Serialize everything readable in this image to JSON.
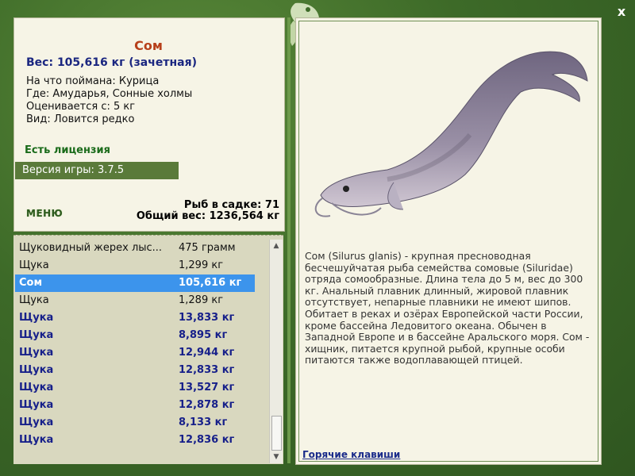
{
  "window": {
    "close_label": "x"
  },
  "fish": {
    "name": "Сом",
    "weight_line": "Вес: 105,616 кг (зачетная)",
    "caught_on": "На что поймана: Курица",
    "where": "Где: Амударья, Сонные холмы",
    "rated_from": "Оценивается с: 5 кг",
    "kind": "Вид: Ловится редко"
  },
  "license": "Есть лицензия",
  "version": "Версия игры: 3.7.5",
  "menu_label": "МЕНЮ",
  "cage": {
    "count": "Рыб в садке: 71",
    "total": "Общий вес: 1236,564 кг"
  },
  "list": [
    {
      "name": "Щуковидный жерех лыс...",
      "weight": "475 грамм",
      "style": "normal"
    },
    {
      "name": "Щука",
      "weight": "1,299 кг",
      "style": "normal"
    },
    {
      "name": "Сом",
      "weight": "105,616 кг",
      "style": "selected"
    },
    {
      "name": "Щука",
      "weight": "1,289 кг",
      "style": "normal"
    },
    {
      "name": "Щука",
      "weight": "13,833 кг",
      "style": "bold"
    },
    {
      "name": "Щука",
      "weight": "8,895 кг",
      "style": "bold"
    },
    {
      "name": "Щука",
      "weight": "12,944 кг",
      "style": "bold"
    },
    {
      "name": "Щука",
      "weight": "12,833 кг",
      "style": "bold"
    },
    {
      "name": "Щука",
      "weight": "13,527 кг",
      "style": "bold"
    },
    {
      "name": "Щука",
      "weight": "12,878 кг",
      "style": "bold"
    },
    {
      "name": "Щука",
      "weight": "8,133 кг",
      "style": "bold"
    },
    {
      "name": "Щука",
      "weight": "12,836 кг",
      "style": "bold"
    }
  ],
  "description": "Сом (Silurus glanis) - крупная пресноводная бесчешуйчатая рыба семейства сомовые (Siluridae) отряда сомообразные. Длина тела до 5 м, вес до 300 кг. Анальный плавник длинный, жировой плавник отсутствует, непарные плавники не имеют шипов. Обитает в реках и озёрах Европейской части России, кроме бассейна Ледовитого океана. Обычен в Западной Европе и в бассейне Аральского моря. Сом - хищник, питается крупной рыбой, крупные особи питаются также водоплавающей птицей.",
  "hotkeys_label": "Горячие клавиши",
  "icons": {
    "close": "close-icon",
    "logo": "leaf-logo-icon",
    "up": "arrow-up-icon",
    "down": "arrow-down-icon"
  },
  "colors": {
    "frame": "#3d6a28",
    "panel": "#f6f4e6",
    "title": "#b7401b",
    "bold_blue": "#17208a",
    "selected": "#3c94ec",
    "version_bar": "#5a7a3a"
  }
}
